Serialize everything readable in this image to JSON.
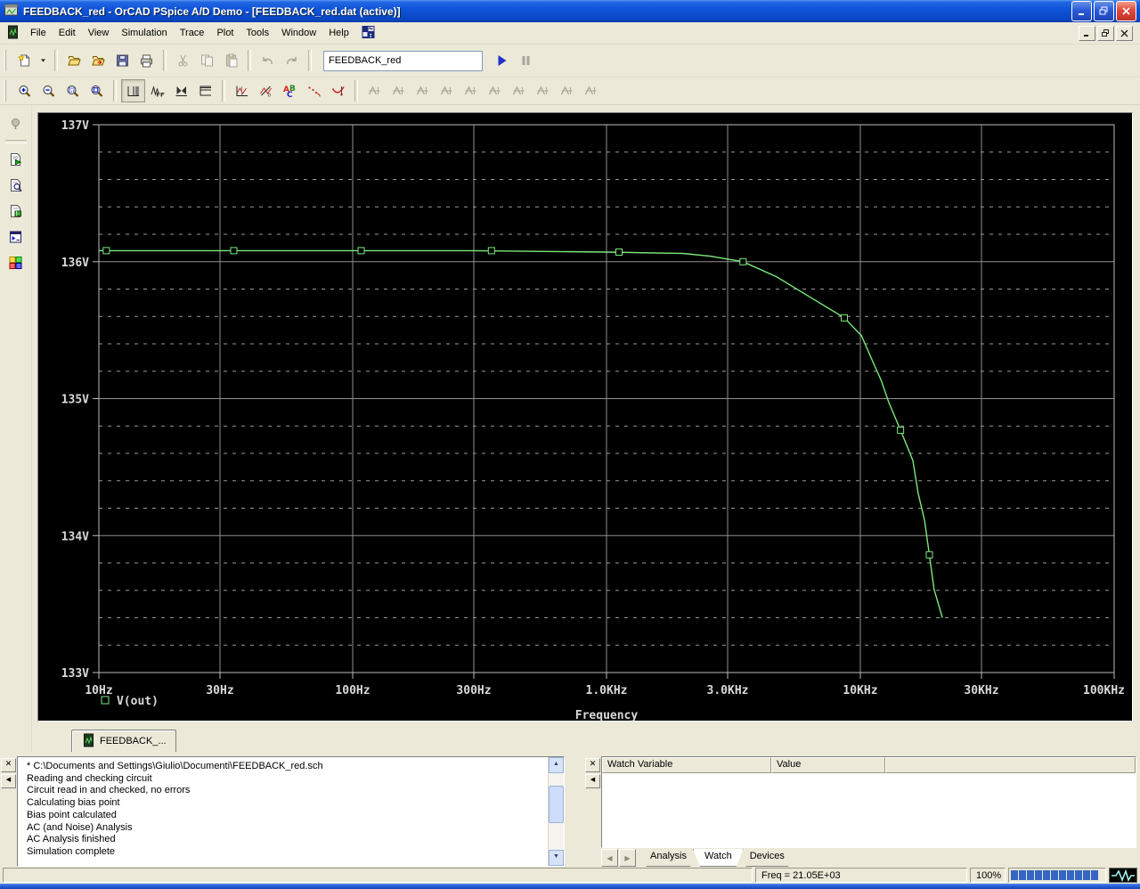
{
  "window": {
    "title": "FEEDBACK_red - OrCAD PSpice A/D Demo  - [FEEDBACK_red.dat (active)]",
    "controls": [
      "minimize",
      "restore",
      "close"
    ]
  },
  "menu_bar": {
    "items": [
      "File",
      "Edit",
      "View",
      "Simulation",
      "Trace",
      "Plot",
      "Tools",
      "Window",
      "Help"
    ]
  },
  "toolbar_main": [
    {
      "name": "new-simulation-button",
      "icon": "new",
      "enabled": true
    },
    {
      "name": "new-dropdown-arrow",
      "icon": "droparrow",
      "enabled": true,
      "narrow": true
    },
    {
      "sep": true
    },
    {
      "name": "open-button",
      "icon": "open",
      "enabled": true
    },
    {
      "name": "append-file-button",
      "icon": "append",
      "enabled": true
    },
    {
      "name": "save-button",
      "icon": "save",
      "enabled": true
    },
    {
      "name": "print-button",
      "icon": "print",
      "enabled": true
    },
    {
      "sep": true
    },
    {
      "name": "cut-button",
      "icon": "cut",
      "enabled": false
    },
    {
      "name": "copy-button",
      "icon": "copy",
      "enabled": false
    },
    {
      "name": "paste-button",
      "icon": "paste",
      "enabled": false
    },
    {
      "sep": true
    },
    {
      "name": "undo-button",
      "icon": "undo",
      "enabled": false
    },
    {
      "name": "redo-button",
      "icon": "redo",
      "enabled": false
    },
    {
      "sep": true
    },
    {
      "combo": true,
      "name": "simulation-profile-combo",
      "value": "FEEDBACK_red"
    },
    {
      "name": "run-button",
      "icon": "run",
      "enabled": true
    },
    {
      "name": "pause-button",
      "icon": "pause",
      "enabled": false
    }
  ],
  "toolbar_plot": [
    {
      "name": "zoom-in-button",
      "icon": "zin",
      "enabled": true
    },
    {
      "name": "zoom-out-button",
      "icon": "zout",
      "enabled": true
    },
    {
      "name": "zoom-area-button",
      "icon": "zarea",
      "enabled": true
    },
    {
      "name": "zoom-fit-button",
      "icon": "zfit",
      "enabled": true
    },
    {
      "sep": true
    },
    {
      "name": "log-x-axis-button",
      "icon": "logx",
      "enabled": true,
      "pressed": true
    },
    {
      "name": "fft-button",
      "icon": "fft",
      "enabled": true
    },
    {
      "name": "performance-analysis-button",
      "icon": "perf",
      "enabled": true
    },
    {
      "name": "log-y-axis-button",
      "icon": "logy",
      "enabled": true
    },
    {
      "sep": true
    },
    {
      "name": "toggle-cursor-button",
      "icon": "ctog",
      "enabled": true
    },
    {
      "name": "mark-data-points-button",
      "icon": "mark",
      "enabled": true
    },
    {
      "name": "text-label-button",
      "icon": "abc",
      "enabled": true
    },
    {
      "name": "annotate-dots-button",
      "icon": "dots",
      "enabled": true
    },
    {
      "name": "evaluate-measurement-button",
      "icon": "eval",
      "enabled": true
    },
    {
      "sep": true
    },
    {
      "name": "cursor-peak-button",
      "icon": "curfn",
      "enabled": false
    },
    {
      "name": "cursor-trough-button",
      "icon": "curfn",
      "enabled": false
    },
    {
      "name": "cursor-slope-button",
      "icon": "curfn",
      "enabled": false
    },
    {
      "name": "cursor-min-button",
      "icon": "curfn",
      "enabled": false
    },
    {
      "name": "cursor-max-button",
      "icon": "curfn",
      "enabled": false
    },
    {
      "name": "cursor-point-button",
      "icon": "curfn",
      "enabled": false
    },
    {
      "name": "cursor-search-button",
      "icon": "curfn",
      "enabled": false
    },
    {
      "name": "cursor-label-button",
      "icon": "curfn",
      "enabled": false
    },
    {
      "name": "cursor-next-button",
      "icon": "curfn",
      "enabled": false
    },
    {
      "name": "cursor-zero-button",
      "icon": "curfn",
      "enabled": false
    }
  ],
  "left_toolbar": [
    {
      "name": "profile-settings-button",
      "icon": "pin",
      "enabled": false,
      "sepafter": true
    },
    {
      "name": "simulation-queue-button",
      "icon": "simq",
      "enabled": true
    },
    {
      "name": "view-circuit-file-button",
      "icon": "docmag",
      "enabled": true
    },
    {
      "name": "view-netlist-button",
      "icon": "docchip",
      "enabled": true
    },
    {
      "name": "view-output-file-button",
      "icon": "cmd",
      "enabled": true
    },
    {
      "name": "view-simulation-results-button",
      "icon": "grid",
      "enabled": true
    }
  ],
  "chart_data": {
    "type": "line",
    "title": "",
    "xlabel": "Frequency",
    "ylabel": "",
    "x_scale": "log",
    "xlim": [
      10,
      100000
    ],
    "ylim": [
      133,
      137
    ],
    "y_major_step": 1,
    "y_minor_step": 0.2,
    "grid": true,
    "x_ticks": [
      {
        "f": 10,
        "label": "10Hz"
      },
      {
        "f": 30,
        "label": "30Hz"
      },
      {
        "f": 100,
        "label": "100Hz"
      },
      {
        "f": 300,
        "label": "300Hz"
      },
      {
        "f": 1000,
        "label": "1.0KHz"
      },
      {
        "f": 3000,
        "label": "3.0KHz"
      },
      {
        "f": 10000,
        "label": "10KHz"
      },
      {
        "f": 30000,
        "label": "30KHz"
      },
      {
        "f": 100000,
        "label": "100KHz"
      }
    ],
    "y_ticks": [
      {
        "v": 133,
        "label": "133V"
      },
      {
        "v": 134,
        "label": "134V"
      },
      {
        "v": 135,
        "label": "135V"
      },
      {
        "v": 136,
        "label": "136V"
      },
      {
        "v": 137,
        "label": "137V"
      }
    ],
    "series": [
      {
        "name": "V(out)",
        "color": "#7ce87c",
        "points": [
          [
            10,
            136.08
          ],
          [
            30,
            136.08
          ],
          [
            100,
            136.08
          ],
          [
            300,
            136.08
          ],
          [
            1000,
            136.07
          ],
          [
            2000,
            136.06
          ],
          [
            2560,
            136.04
          ],
          [
            3450,
            136.0
          ],
          [
            4680,
            135.89
          ],
          [
            6350,
            135.74
          ],
          [
            8650,
            135.59
          ],
          [
            10100,
            135.46
          ],
          [
            11200,
            135.27
          ],
          [
            12100,
            135.13
          ],
          [
            12900,
            134.98
          ],
          [
            14400,
            134.77
          ],
          [
            16100,
            134.55
          ],
          [
            16900,
            134.31
          ],
          [
            17900,
            134.11
          ],
          [
            18700,
            133.86
          ],
          [
            19500,
            133.61
          ],
          [
            21050,
            133.4
          ]
        ],
        "markers": [
          [
            10.7,
            136.08
          ],
          [
            34,
            136.08
          ],
          [
            108,
            136.08
          ],
          [
            352,
            136.08
          ],
          [
            1120,
            136.07
          ],
          [
            3450,
            136.0
          ],
          [
            8650,
            135.59
          ],
          [
            14400,
            134.77
          ],
          [
            18700,
            133.86
          ]
        ]
      }
    ],
    "legend_position": "bottom-left"
  },
  "plot_tab": {
    "label": "FEEDBACK_..."
  },
  "output_window": {
    "lines": [
      "* C:\\Documents and Settings\\Giulio\\Documenti\\FEEDBACK_red.sch",
      "Reading and checking circuit",
      "Circuit read in and checked, no errors",
      "Calculating bias point",
      "Bias point calculated",
      "AC (and Noise) Analysis",
      "AC Analysis finished",
      "Simulation complete"
    ]
  },
  "watch_window": {
    "columns": [
      "Watch Variable",
      "Value"
    ],
    "rows": [],
    "tabs": [
      "Analysis",
      "Watch",
      "Devices"
    ],
    "active_tab": "Watch"
  },
  "status_bar": {
    "freq": "Freq =  21.05E+03",
    "zoom": "100%",
    "progress_segments": 11
  },
  "colors": {
    "titlebar_blue": "#0f54da",
    "chrome": "#ece9d8",
    "plot_bg": "#000000",
    "trace_green": "#7ce87c",
    "grid_gray": "#9a9a9a",
    "progress_blue": "#3566c4"
  }
}
